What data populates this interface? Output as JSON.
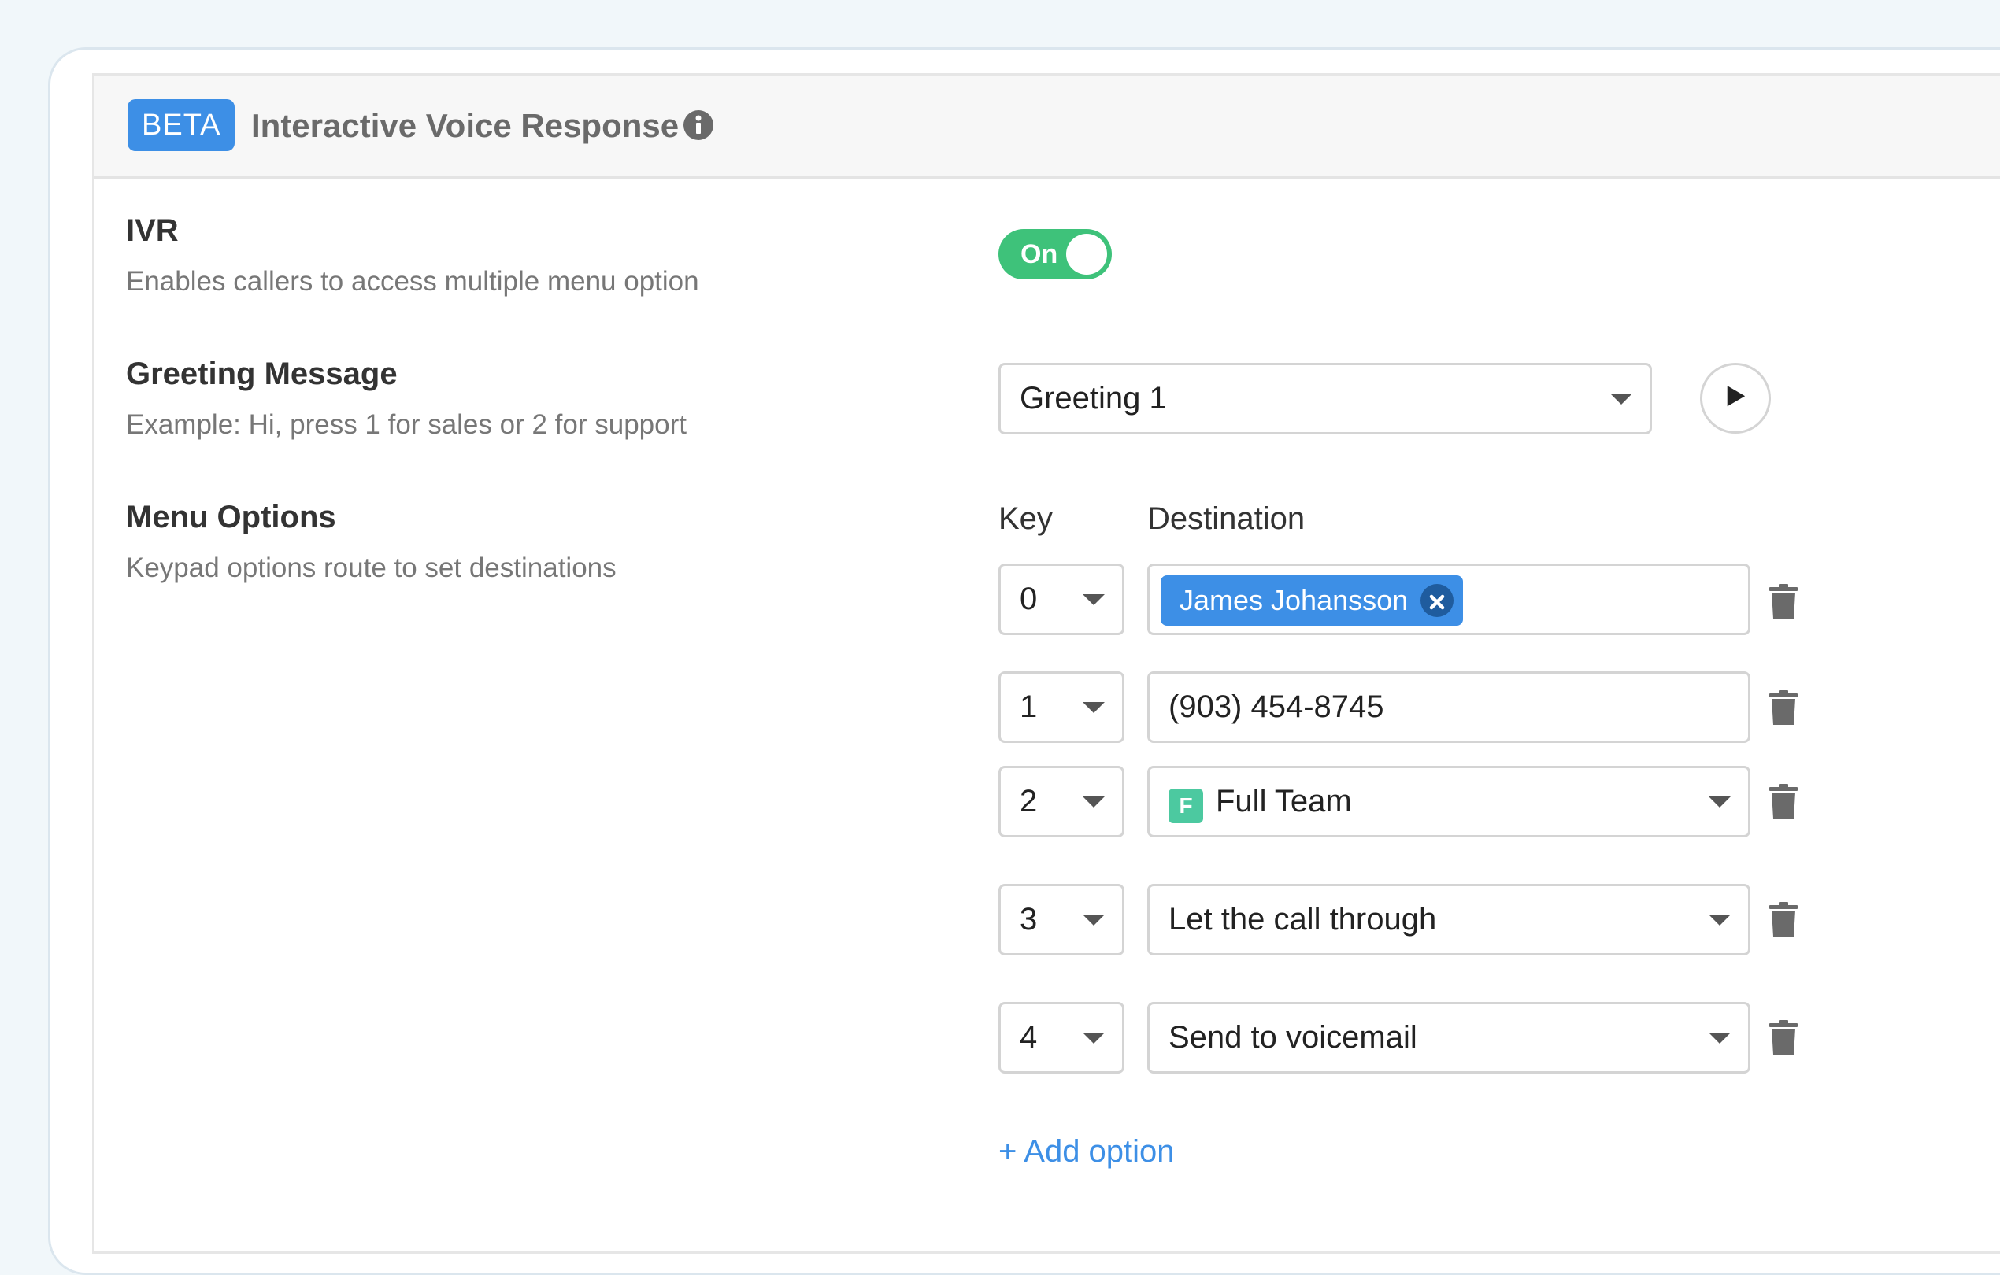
{
  "header": {
    "badge": "BETA",
    "title": "Interactive Voice Response"
  },
  "ivr": {
    "title": "IVR",
    "description": "Enables callers to access multiple menu option",
    "toggle_label": "On"
  },
  "greeting": {
    "title": "Greeting Message",
    "description": "Example: Hi, press 1 for sales or 2 for support",
    "selected": "Greeting 1"
  },
  "menu": {
    "title": "Menu Options",
    "description": "Keypad options route to set destinations",
    "key_label": "Key",
    "destination_label": "Destination",
    "options": [
      {
        "key": "0",
        "destination": "James Johansson"
      },
      {
        "key": "1",
        "destination": "(903) 454-8745"
      },
      {
        "key": "2",
        "destination": "Full Team",
        "avatar": "F"
      },
      {
        "key": "3",
        "destination": "Let the call through"
      },
      {
        "key": "4",
        "destination": "Send to voicemail"
      }
    ],
    "add_option": "+ Add option"
  },
  "colors": {
    "accent": "#3d8fe6",
    "toggle_on": "#3ec27a",
    "team_avatar": "#4cc9a0"
  }
}
